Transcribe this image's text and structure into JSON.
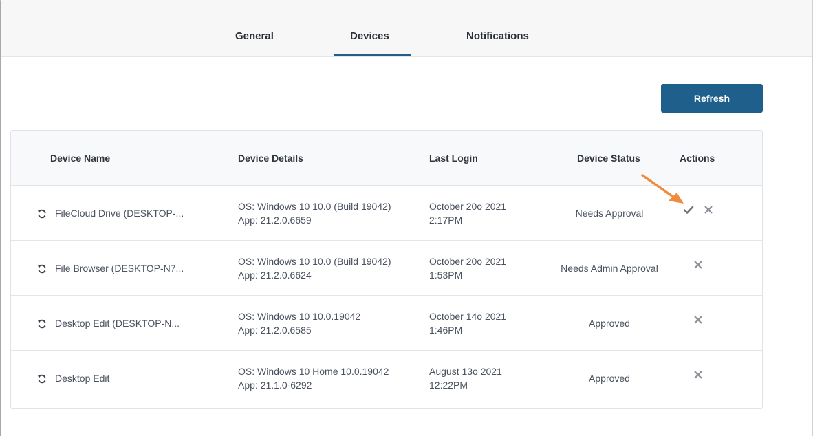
{
  "tabs": {
    "general": "General",
    "devices": "Devices",
    "notifications": "Notifications",
    "active": "devices"
  },
  "toolbar": {
    "refresh_label": "Refresh"
  },
  "table": {
    "headers": {
      "name": "Device Name",
      "details": "Device Details",
      "login": "Last Login",
      "status": "Device Status",
      "actions": "Actions"
    },
    "rows": [
      {
        "name": "FileCloud Drive (DESKTOP-...",
        "os": "OS: Windows 10 10.0 (Build 19042)",
        "app": "App: 21.2.0.6659",
        "login_date": "October 20o 2021",
        "login_time": "2:17PM",
        "status": "Needs Approval",
        "actions": [
          "approve-icon",
          "reject-icon"
        ]
      },
      {
        "name": "File Browser (DESKTOP-N7...",
        "os": "OS: Windows 10 10.0 (Build 19042)",
        "app": "App: 21.2.0.6624",
        "login_date": "October 20o 2021",
        "login_time": "1:53PM",
        "status": "Needs Admin Approval",
        "actions": [
          "reject-icon"
        ]
      },
      {
        "name": "Desktop Edit (DESKTOP-N...",
        "os": "OS: Windows 10 10.0.19042",
        "app": "App: 21.2.0.6585",
        "login_date": "October 14o 2021",
        "login_time": "1:46PM",
        "status": "Approved",
        "actions": [
          "reject-icon"
        ]
      },
      {
        "name": "Desktop Edit",
        "os": "OS: Windows 10 Home 10.0.19042",
        "app": "App: 21.1.0-6292",
        "login_date": "August 13o 2021",
        "login_time": "12:22PM",
        "status": "Approved",
        "actions": [
          "reject-icon"
        ]
      }
    ]
  },
  "colors": {
    "accent": "#1f5f8b",
    "annotation_arrow": "#f08a3c",
    "icon_gray": "#8a9099"
  }
}
